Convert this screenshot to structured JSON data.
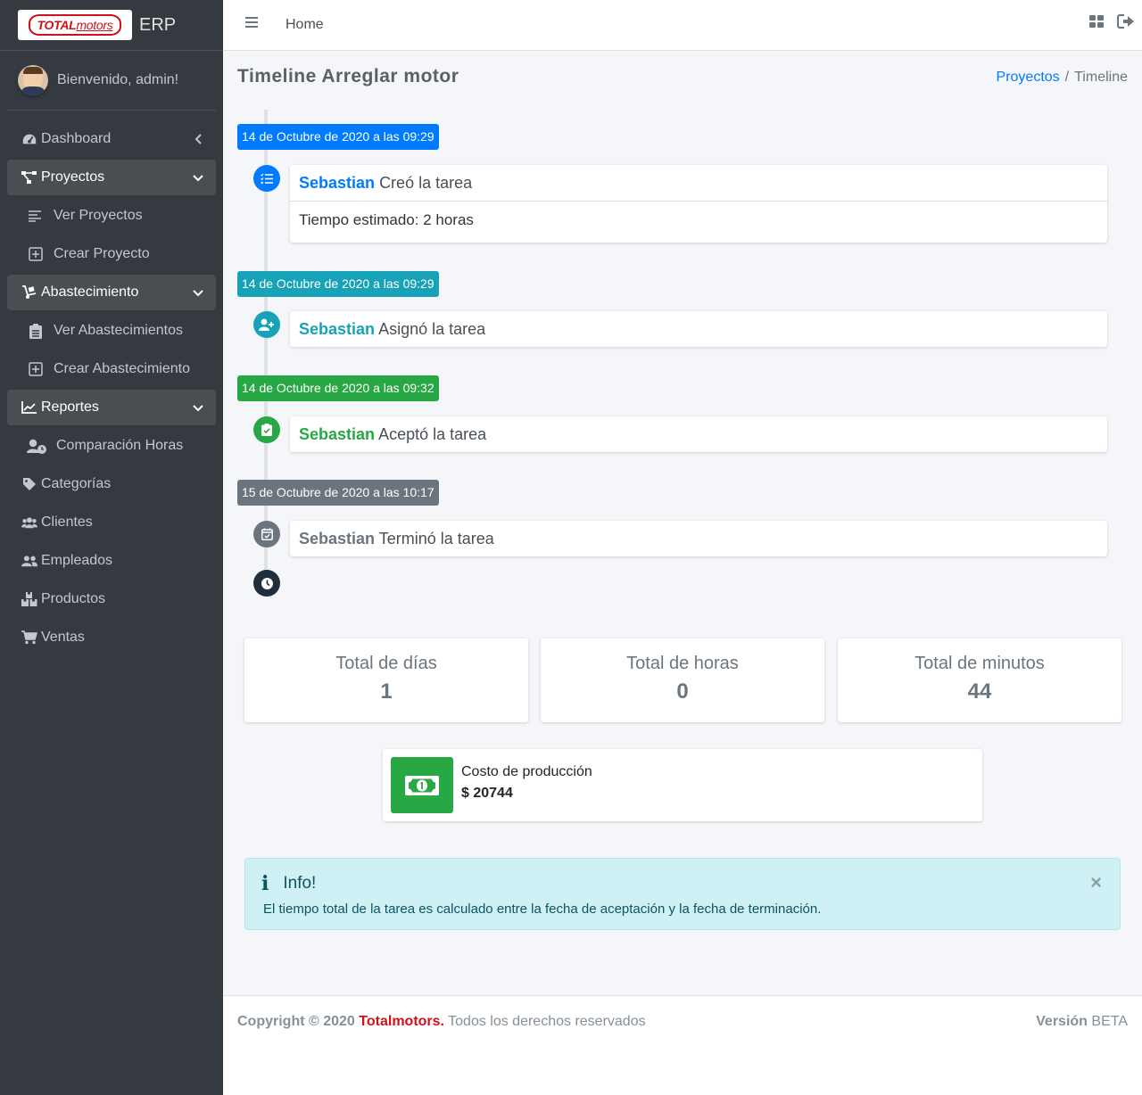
{
  "brand": {
    "logo_text_a": "TOTAL",
    "logo_text_b": "motors",
    "app_name": "ERP"
  },
  "user": {
    "welcome": "Bienvenido, admin!"
  },
  "sidebar": {
    "dashboard": "Dashboard",
    "proyectos": "Proyectos",
    "ver_proyectos": "Ver Proyectos",
    "crear_proyecto": "Crear Proyecto",
    "abastecimiento": "Abastecimiento",
    "ver_abastecimientos": "Ver Abastecimientos",
    "crear_abastecimiento": "Crear Abastecimiento",
    "reportes": "Reportes",
    "comparacion_horas": "Comparación Horas",
    "categorias": "Categorías",
    "clientes": "Clientes",
    "empleados": "Empleados",
    "productos": "Productos",
    "ventas": "Ventas"
  },
  "header": {
    "home": "Home"
  },
  "page": {
    "title": "Timeline Arreglar motor",
    "breadcrumb_link": "Proyectos",
    "breadcrumb_sep": "/",
    "breadcrumb_current": "Timeline"
  },
  "timeline": [
    {
      "date": "14 de Octubre de 2020 a las 09:29",
      "user": "Sebastian",
      "action": "Creó la tarea",
      "detail": "Tiempo estimado: 2 horas",
      "color": "#007bff",
      "icon": "tasks-icon"
    },
    {
      "date": "14 de Octubre de 2020 a las 09:29",
      "user": "Sebastian",
      "action": "Asignó la tarea",
      "color": "#17a2b8",
      "icon": "user-plus-icon"
    },
    {
      "date": "14 de Octubre de 2020 a las 09:32",
      "user": "Sebastian",
      "action": "Aceptó la tarea",
      "color": "#28a745",
      "icon": "clipboard-check-icon"
    },
    {
      "date": "15 de Octubre de 2020 a las 10:17",
      "user": "Sebastian",
      "action": "Terminó la tarea",
      "color": "#6c757d",
      "icon": "calendar-check-icon"
    }
  ],
  "stats": {
    "dias_label": "Total de días",
    "dias_value": "1",
    "horas_label": "Total de horas",
    "horas_value": "0",
    "minutos_label": "Total de minutos",
    "minutos_value": "44"
  },
  "cost": {
    "label": "Costo de producción",
    "value": "$ 20744"
  },
  "alert": {
    "title": "Info!",
    "text": "El tiempo total de la tarea es calculado entre la fecha de aceptación y la fecha de terminación.",
    "close": "×"
  },
  "footer": {
    "copyright": "Copyright © 2020",
    "brand": "Totalmotors.",
    "rights": "Todos los derechos reservados",
    "version_label": "Versión",
    "version_value": "BETA"
  }
}
